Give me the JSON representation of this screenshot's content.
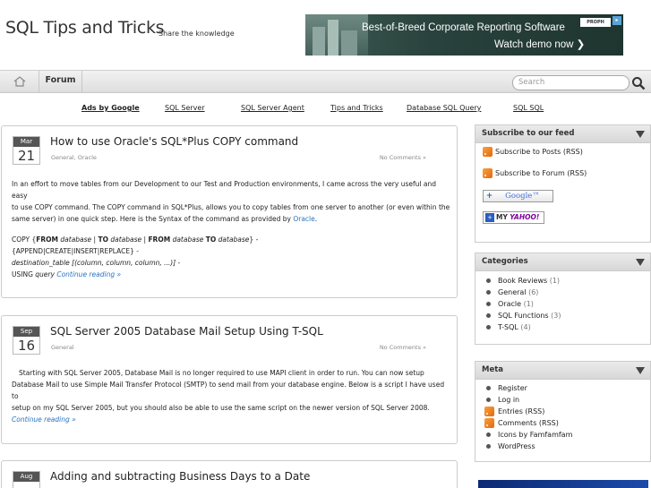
{
  "header": {
    "title": "SQL Tips and Tricks",
    "tagline": "Share the knowledge",
    "banner": {
      "line1": "Best-of-Breed Corporate Reporting Software",
      "line2": "Watch demo now ❯",
      "logo": "PROPH"
    }
  },
  "nav": {
    "home_icon": "home-icon",
    "forum_label": "Forum",
    "search_placeholder": "Search"
  },
  "ads": {
    "ads_by": "Ads by Google",
    "links": [
      "SQL Server",
      "SQL Server Agent",
      "Tips and Tricks",
      "Database SQL Query",
      "SQL SQL"
    ]
  },
  "posts": [
    {
      "month": "Mar",
      "day": "21",
      "title": "How to use Oracle's SQL*Plus COPY command",
      "categories": "General, Oracle",
      "comments": "No Comments »",
      "intro_1": "In an effort to move tables from our Development to our Test and Production environments, I came across the very useful and easy",
      "intro_2": "to use COPY command. The COPY command in SQL*Plus, allows you to copy tables from one server to another (or even within the",
      "intro_3": "same server) in one quick step. Here is the Syntax of the command as provided by",
      "intro_link": "Oracle",
      "code_copy": "COPY {",
      "code_from": "FROM",
      "code_database": "database",
      "code_to": "TO",
      "code_line2": "{APPEND|CREATE|INSERT|REPLACE} -",
      "code_line3_a": "destination_table",
      "code_line3_b": "[(column, column, column, ...)] -",
      "code_using": "USING",
      "code_query": "query",
      "more": "Continue reading »"
    },
    {
      "month": "Sep",
      "day": "16",
      "title": "SQL Server 2005 Database Mail Setup Using T-SQL",
      "categories": "General",
      "comments": "No Comments »",
      "body_1": "Starting with SQL Server 2005, Database Mail is no longer required to use MAPI client in order to run. You can now setup",
      "body_2": "Database Mail to use Simple Mail Transfer Protocol (SMTP) to send mail from your database engine. Below is a script I have used to",
      "body_3": "setup on my SQL Server 2005, but you should also be able to use the same script on the newer version of SQL Server 2008.",
      "more": "Continue reading »"
    },
    {
      "month": "Aug",
      "day": "",
      "title": "Adding and subtracting Business Days to a Date"
    }
  ],
  "sidebar": {
    "feed": {
      "title": "Subscribe to our feed",
      "posts_rss": "Subscribe to Posts (RSS)",
      "forum_rss": "Subscribe to Forum (RSS)",
      "google_plus": "+",
      "google": "Google™",
      "yahoo_plus": "+",
      "yahoo_my": "MY",
      "yahoo_name": "YAHOO!"
    },
    "categories": {
      "title": "Categories",
      "items": [
        {
          "label": "Book Reviews",
          "count": "(1)"
        },
        {
          "label": "General",
          "count": "(6)"
        },
        {
          "label": "Oracle",
          "count": "(1)"
        },
        {
          "label": "SQL Functions",
          "count": "(3)"
        },
        {
          "label": "T-SQL",
          "count": "(4)"
        }
      ]
    },
    "meta": {
      "title": "Meta",
      "items": [
        "Register",
        "Log in",
        "Entries (RSS)",
        "Comments (RSS)",
        "Icons by Famfamfam",
        "WordPress"
      ]
    }
  }
}
